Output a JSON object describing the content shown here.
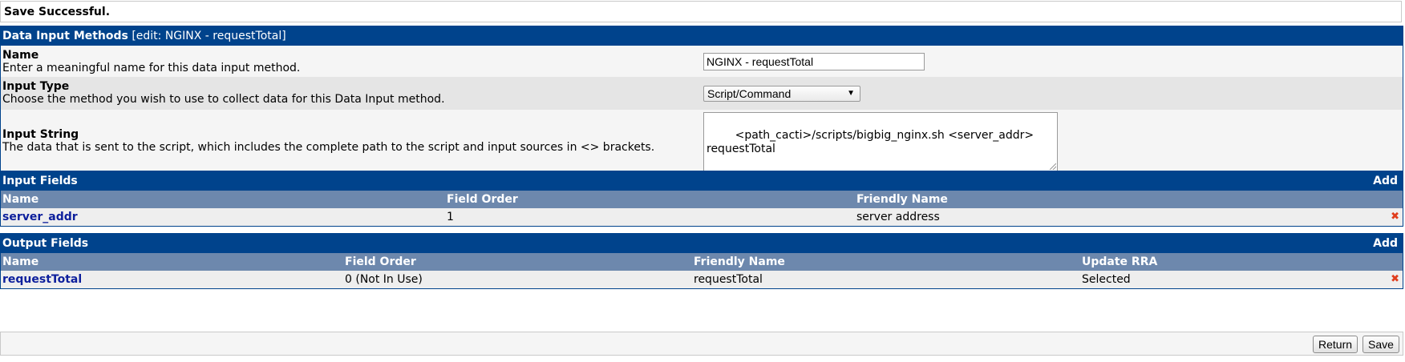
{
  "message": "Save Successful.",
  "dim": {
    "title_bold": "Data Input Methods",
    "title_rest": "[edit: NGINX - requestTotal]",
    "name": {
      "label": "Name",
      "desc": "Enter a meaningful name for this data input method.",
      "value": "NGINX - requestTotal"
    },
    "input_type": {
      "label": "Input Type",
      "desc": "Choose the method you wish to use to collect data for this Data Input method.",
      "selected": "Script/Command"
    },
    "input_string": {
      "label": "Input String",
      "desc": "The data that is sent to the script, which includes the complete path to the script and input sources in <> brackets.",
      "value": "<path_cacti>/scripts/bigbig_nginx.sh <server_addr>\nrequestTotal"
    }
  },
  "input_fields": {
    "title": "Input Fields",
    "add": "Add",
    "columns": [
      "Name",
      "Field Order",
      "Friendly Name"
    ],
    "rows": [
      {
        "name": "server_addr",
        "order": "1",
        "friendly": "server address"
      }
    ]
  },
  "output_fields": {
    "title": "Output Fields",
    "add": "Add",
    "columns": [
      "Name",
      "Field Order",
      "Friendly Name",
      "Update RRA"
    ],
    "rows": [
      {
        "name": "requestTotal",
        "order": "0 (Not In Use)",
        "friendly": "requestTotal",
        "rra": "Selected"
      }
    ]
  },
  "buttons": {
    "return": "Return",
    "save": "Save"
  },
  "icons": {
    "delete": "delete-icon",
    "dropdown": "chevron-down-icon"
  },
  "colors": {
    "header": "#00438c",
    "subheader": "#6d88ad",
    "link": "#0d1f9c",
    "delete": "#e03c1c"
  }
}
